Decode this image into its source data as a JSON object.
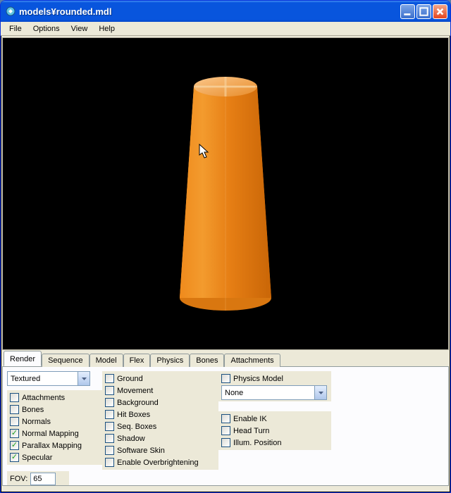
{
  "window": {
    "title": "models¥rounded.mdl"
  },
  "menu": {
    "file": "File",
    "options": "Options",
    "view": "View",
    "help": "Help"
  },
  "tabs": {
    "render": "Render",
    "sequence": "Sequence",
    "model": "Model",
    "flex": "Flex",
    "physics": "Physics",
    "bones": "Bones",
    "attachments": "Attachments"
  },
  "render": {
    "displayMode": "Textured",
    "physicsDropdown": "None",
    "col1": {
      "attachments": "Attachments",
      "bones": "Bones",
      "normals": "Normals",
      "normalMapping": "Normal Mapping",
      "parallax": "Parallax Mapping",
      "specular": "Specular"
    },
    "col2": {
      "ground": "Ground",
      "movement": "Movement",
      "background": "Background",
      "hitboxes": "Hit Boxes",
      "seqboxes": "Seq. Boxes",
      "shadow": "Shadow",
      "softwareSkin": "Software Skin",
      "enableOverbright": "Enable Overbrightening"
    },
    "col3": {
      "physicsModel": "Physics Model",
      "enableIK": "Enable IK",
      "headTurn": "Head Turn",
      "illumPosition": "Illum. Position"
    },
    "checked": {
      "normalMapping": "✓",
      "parallax": "✓",
      "specular": "✓"
    },
    "fovLabel": "FOV:",
    "fov": "65"
  }
}
